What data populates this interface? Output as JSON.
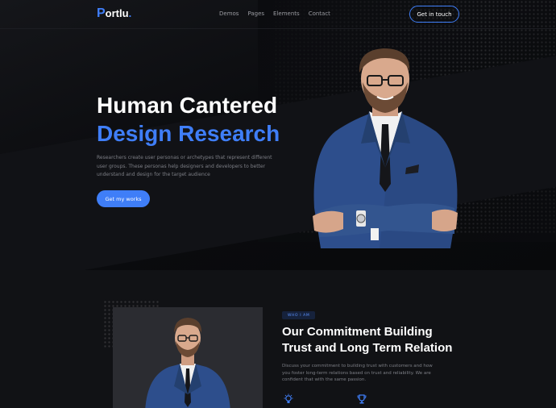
{
  "nav": {
    "logo_initial": "P",
    "logo_rest": "ortlu",
    "logo_dot": ".",
    "menu": [
      "Demos",
      "Pages",
      "Elements",
      "Contact"
    ],
    "cta": "Get in touch"
  },
  "hero": {
    "title_line1": "Human Cantered",
    "title_line2": "Design Research",
    "description": "Researchers create user personas or archetypes that represent different user groups. These personas help designers and developers to better understand and design for the target audience",
    "button": "Get my works"
  },
  "about": {
    "badge": "WHO I AM",
    "title_line1": "Our Commitment Building",
    "title_line2": "Trust and Long Term Relation",
    "description": "Discuss your commitment to building trust with customers and how you foster long-term relations based on trust and reliability. We are confident that with the same passion.",
    "icons": [
      "lightbulb-icon",
      "trophy-icon"
    ]
  },
  "colors": {
    "accent": "#3f7ef8",
    "background": "#0c0d10",
    "section": "#111215"
  }
}
